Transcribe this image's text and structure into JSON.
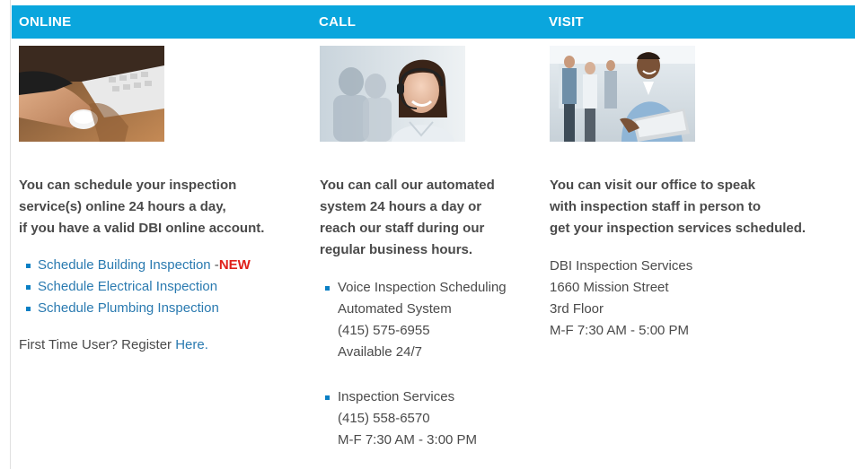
{
  "header": {
    "online_title": "ONLINE",
    "call_title": "CALL",
    "visit_title": "VISIT",
    "bar_color": "#0aa6dd"
  },
  "online": {
    "image_icon": "hand-on-computer-mouse-photo",
    "intro_line1": "You can schedule your inspection",
    "intro_line2": "service(s) online 24 hours a day,",
    "intro_line3": "if you have a valid DBI online account.",
    "links": [
      {
        "label": "Schedule Building Inspection",
        "suffix_dash": " -",
        "badge": "NEW"
      },
      {
        "label": "Schedule Electrical Inspection"
      },
      {
        "label": "Schedule Plumbing Inspection"
      }
    ],
    "register_prefix": "First Time User? Register ",
    "register_link": "Here."
  },
  "call": {
    "image_icon": "call-center-agent-headset-photo",
    "intro_line1": "You can call our automated",
    "intro_line2": "system 24 hours a day or",
    "intro_line3": "reach our staff during our",
    "intro_line4": "regular business hours.",
    "ivr": {
      "title": "Voice Inspection Scheduling",
      "line2": "Automated System",
      "phone": "(415) 575-6955",
      "availability": "Available 24/7"
    },
    "staff": {
      "title": "Inspection Services",
      "phone": "(415) 558-6570",
      "hours": "M-F 7:30 AM - 3:00 PM"
    }
  },
  "visit": {
    "image_icon": "inspector-with-laptop-photo",
    "intro_line1": "You can visit our office to speak",
    "intro_line2": "with inspection staff in person to",
    "intro_line3": "get your inspection services scheduled.",
    "office_name": "DBI Inspection Services",
    "street": "1660 Mission Street",
    "floor": "3rd Floor",
    "hours": "M-F 7:30 AM - 5:00 PM"
  },
  "colors": {
    "link": "#2a7ab0",
    "new_badge": "#e0201b",
    "bullet": "#0a7fc4"
  }
}
